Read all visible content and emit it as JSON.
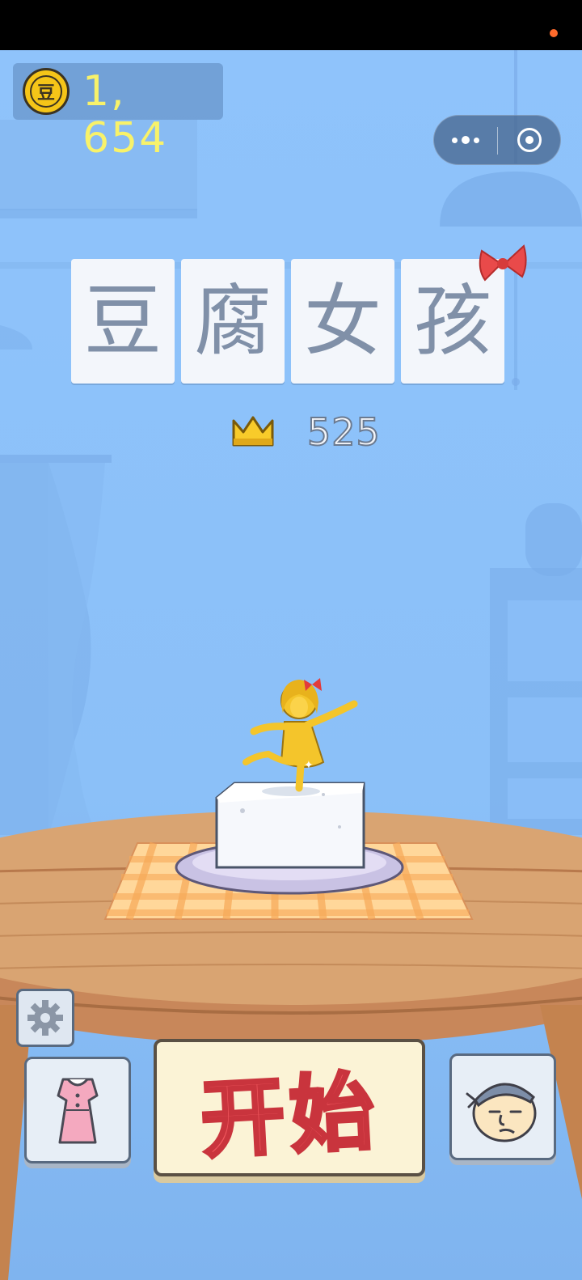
{
  "status": {
    "notification_dot_color": "#ff6b2c"
  },
  "wallet": {
    "coin_label": "豆",
    "coin_count": "1, 654"
  },
  "capsule": {
    "more_icon": "more-dots-icon",
    "close_icon": "target-icon"
  },
  "title": {
    "chars": [
      "豆",
      "腐",
      "女",
      "孩"
    ]
  },
  "best": {
    "icon": "crown-icon",
    "score": "525"
  },
  "buttons": {
    "settings_icon": "gear-icon",
    "wardrobe_icon": "dress-icon",
    "start_label": "开始",
    "character_icon": "chef-face-icon"
  },
  "colors": {
    "sky": "#8fc3fb",
    "title_text": "#8090a8",
    "coin_text": "#f8f26a",
    "start_text": "#f0575e"
  }
}
